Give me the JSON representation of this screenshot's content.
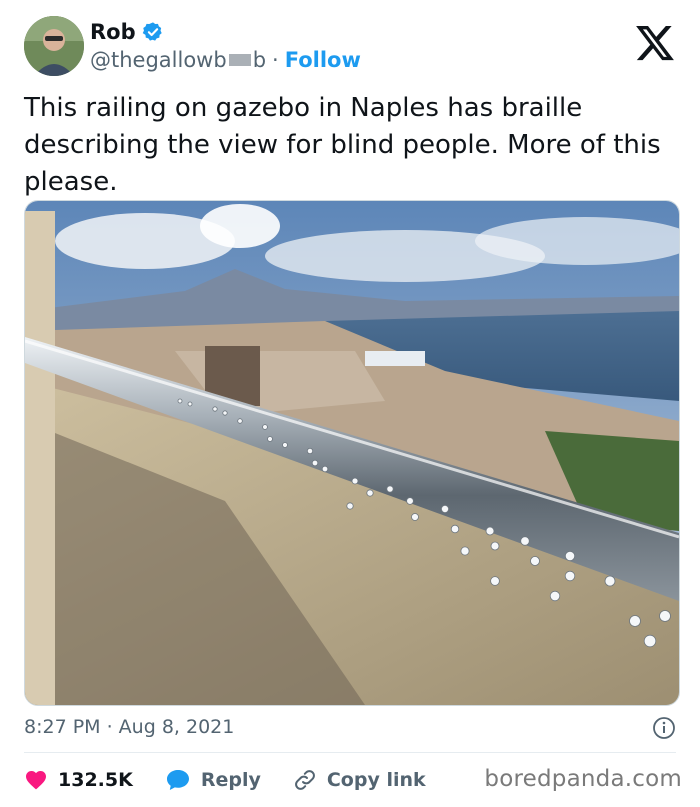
{
  "author": {
    "name": "Rob",
    "handle_prefix": "@thegallowb",
    "handle_suffix": "b",
    "follow_label": "Follow",
    "verified": true
  },
  "tweet": {
    "text": "This railing on gazebo in Naples has braille describing the view for blind people. More of this please.",
    "timestamp": "8:27 PM · Aug 8, 2021"
  },
  "actions": {
    "likes": "132.5K",
    "reply_label": "Reply",
    "copy_label": "Copy link"
  },
  "watermark": "boredpanda.com",
  "colors": {
    "accent": "#1d9bf0",
    "like": "#f91880",
    "muted": "#536471"
  }
}
